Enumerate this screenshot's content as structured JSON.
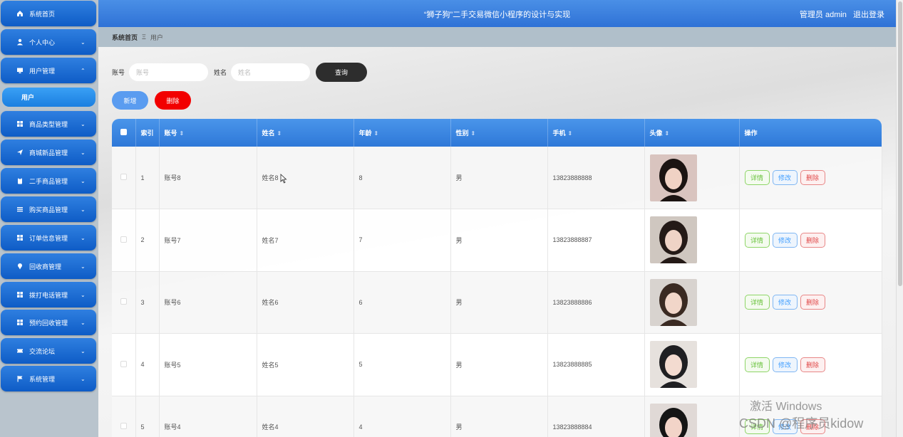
{
  "header": {
    "title": "“狮子狗”二手交易微信小程序的设计与实现",
    "user": "管理员 admin",
    "logout": "退出登录"
  },
  "sidebar": {
    "items": [
      {
        "label": "系统首页",
        "icon": "home-icon"
      },
      {
        "label": "个人中心",
        "icon": "user-icon"
      },
      {
        "label": "用户管理",
        "icon": "monitor-icon",
        "expanded": true
      },
      {
        "label": "商品类型管理",
        "icon": "grid-icon"
      },
      {
        "label": "商城新品管理",
        "icon": "send-icon"
      },
      {
        "label": "二手商品管理",
        "icon": "clipboard-icon"
      },
      {
        "label": "购买商品管理",
        "icon": "list-icon"
      },
      {
        "label": "订单信息管理",
        "icon": "grid-icon"
      },
      {
        "label": "回收商管理",
        "icon": "pin-icon"
      },
      {
        "label": "拨打电话管理",
        "icon": "grid-icon"
      },
      {
        "label": "预约回收管理",
        "icon": "grid-icon"
      },
      {
        "label": "交流论坛",
        "icon": "ticket-icon"
      },
      {
        "label": "系统管理",
        "icon": "flag-icon"
      }
    ],
    "sub_item": "用户"
  },
  "breadcrumb": {
    "home": "系统首页",
    "sep": "Ξ",
    "current": "用户"
  },
  "search": {
    "account_label": "账号",
    "account_placeholder": "账号",
    "name_label": "姓名",
    "name_placeholder": "姓名",
    "query_button": "查询"
  },
  "actions": {
    "add": "新增",
    "delete": "删除"
  },
  "table": {
    "columns": [
      "索引",
      "账号",
      "姓名",
      "年龄",
      "性别",
      "手机",
      "头像",
      "操作"
    ],
    "rows": [
      {
        "index": "1",
        "account": "账号8",
        "name": "姓名8",
        "age": "8",
        "gender": "男",
        "phone": "13823888888"
      },
      {
        "index": "2",
        "account": "账号7",
        "name": "姓名7",
        "age": "7",
        "gender": "男",
        "phone": "13823888887"
      },
      {
        "index": "3",
        "account": "账号6",
        "name": "姓名6",
        "age": "6",
        "gender": "男",
        "phone": "13823888886"
      },
      {
        "index": "4",
        "account": "账号5",
        "name": "姓名5",
        "age": "5",
        "gender": "男",
        "phone": "13823888885"
      },
      {
        "index": "5",
        "account": "账号4",
        "name": "姓名4",
        "age": "4",
        "gender": "男",
        "phone": "13823888884"
      }
    ],
    "ops": {
      "detail": "详情",
      "edit": "修改",
      "delete": "删除"
    }
  },
  "overlay": {
    "windows": "激活 Windows",
    "csdn": "CSDN @程序员kidow"
  },
  "colors": {
    "primary": "#2f72d6",
    "danger": "#f20000",
    "dark": "#2d2d2d"
  }
}
